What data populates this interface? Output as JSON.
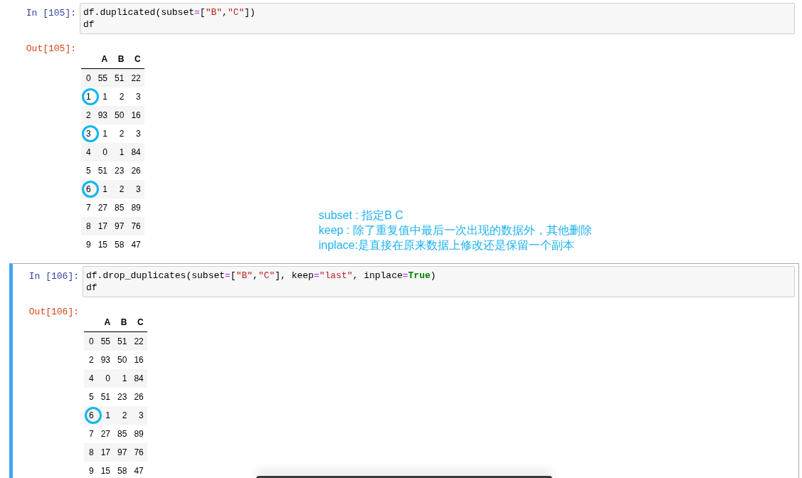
{
  "cells": [
    {
      "selected": false,
      "in_prompt": "In [105]:",
      "code": [
        [
          {
            "kind": "plain",
            "text": "df.duplicated(subset"
          },
          {
            "kind": "op",
            "text": "="
          },
          {
            "kind": "plain",
            "text": "["
          },
          {
            "kind": "str",
            "text": "\"B\""
          },
          {
            "kind": "plain",
            "text": ","
          },
          {
            "kind": "str",
            "text": "\"C\""
          },
          {
            "kind": "plain",
            "text": "])"
          }
        ],
        [
          {
            "kind": "plain",
            "text": "df"
          }
        ]
      ],
      "out_prompt": "Out[105]:",
      "table": {
        "columns": [
          "A",
          "B",
          "C"
        ],
        "rows": [
          {
            "index": "0",
            "values": [
              "55",
              "51",
              "22"
            ],
            "circled": false
          },
          {
            "index": "1",
            "values": [
              "1",
              "2",
              "3"
            ],
            "circled": true
          },
          {
            "index": "2",
            "values": [
              "93",
              "50",
              "16"
            ],
            "circled": false
          },
          {
            "index": "3",
            "values": [
              "1",
              "2",
              "3"
            ],
            "circled": true
          },
          {
            "index": "4",
            "values": [
              "0",
              "1",
              "84"
            ],
            "circled": false
          },
          {
            "index": "5",
            "values": [
              "51",
              "23",
              "26"
            ],
            "circled": false
          },
          {
            "index": "6",
            "values": [
              "1",
              "2",
              "3"
            ],
            "circled": true
          },
          {
            "index": "7",
            "values": [
              "27",
              "85",
              "89"
            ],
            "circled": false
          },
          {
            "index": "8",
            "values": [
              "17",
              "97",
              "76"
            ],
            "circled": false
          },
          {
            "index": "9",
            "values": [
              "15",
              "58",
              "47"
            ],
            "circled": false
          }
        ]
      },
      "note": [
        "subset : 指定B C",
        "keep : 除了重复值中最后一次出现的数据外，其他删除",
        "inplace:是直接在原来数据上修改还是保留一个副本"
      ]
    },
    {
      "selected": true,
      "in_prompt": "In [106]:",
      "code": [
        [
          {
            "kind": "plain",
            "text": "df.drop_duplicates(subset"
          },
          {
            "kind": "op",
            "text": "="
          },
          {
            "kind": "plain",
            "text": "["
          },
          {
            "kind": "str",
            "text": "\"B\""
          },
          {
            "kind": "plain",
            "text": ","
          },
          {
            "kind": "str",
            "text": "\"C\""
          },
          {
            "kind": "plain",
            "text": "], keep"
          },
          {
            "kind": "op",
            "text": "="
          },
          {
            "kind": "str",
            "text": "\"last\""
          },
          {
            "kind": "plain",
            "text": ", inplace"
          },
          {
            "kind": "op",
            "text": "="
          },
          {
            "kind": "kw",
            "text": "True"
          },
          {
            "kind": "plain",
            "text": ")"
          }
        ],
        [
          {
            "kind": "plain",
            "text": "df"
          }
        ]
      ],
      "out_prompt": "Out[106]:",
      "table": {
        "columns": [
          "A",
          "B",
          "C"
        ],
        "rows": [
          {
            "index": "0",
            "values": [
              "55",
              "51",
              "22"
            ],
            "circled": false
          },
          {
            "index": "2",
            "values": [
              "93",
              "50",
              "16"
            ],
            "circled": false
          },
          {
            "index": "4",
            "values": [
              "0",
              "1",
              "84"
            ],
            "circled": false
          },
          {
            "index": "5",
            "values": [
              "51",
              "23",
              "26"
            ],
            "circled": false
          },
          {
            "index": "6",
            "values": [
              "1",
              "2",
              "3"
            ],
            "circled": true
          },
          {
            "index": "7",
            "values": [
              "27",
              "85",
              "89"
            ],
            "circled": false
          },
          {
            "index": "8",
            "values": [
              "17",
              "97",
              "76"
            ],
            "circled": false
          },
          {
            "index": "9",
            "values": [
              "15",
              "58",
              "47"
            ],
            "circled": false
          }
        ]
      }
    }
  ]
}
